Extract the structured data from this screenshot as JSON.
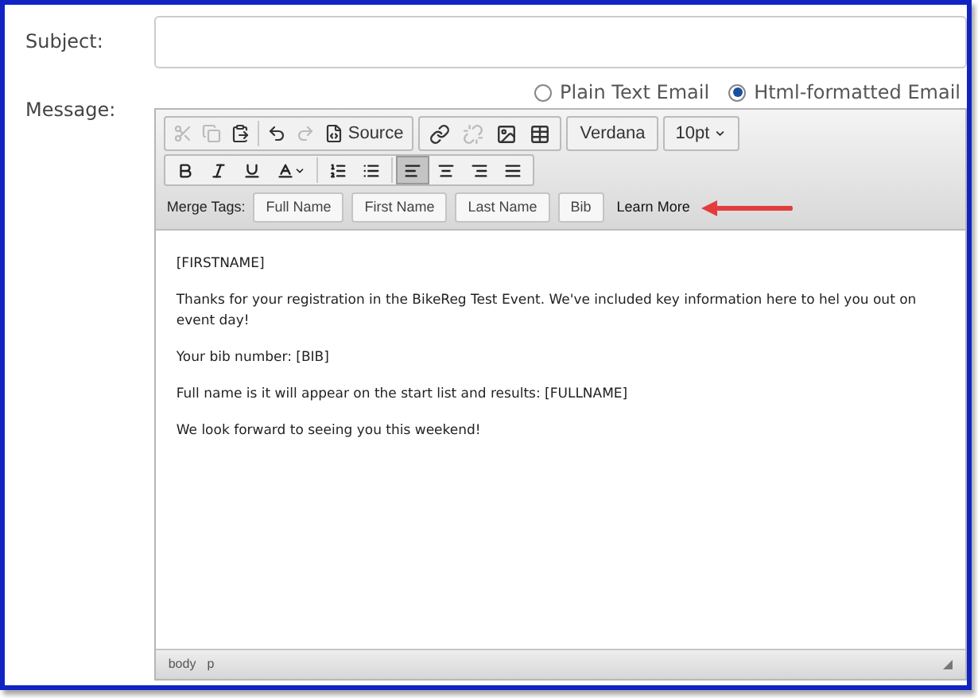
{
  "subject": {
    "label": "Subject:"
  },
  "message": {
    "label": "Message:"
  },
  "format_options": [
    {
      "label": "Plain Text Email",
      "selected": false
    },
    {
      "label": "Html-formatted Email",
      "selected": true
    }
  ],
  "toolbar_row_1": {
    "edit_group": [
      {
        "disabled": true
      },
      {
        "disabled": true
      },
      {
        "disabled": false
      },
      {
        "disabled": false
      },
      {
        "disabled": true
      },
      {
        "label": "Source",
        "disabled": false
      }
    ],
    "insert_group": [
      {
        "disabled": false
      },
      {
        "disabled": true
      },
      {
        "disabled": false
      },
      {
        "disabled": false
      }
    ],
    "font_family": {
      "value": "Verdana"
    },
    "font_size": {
      "value": "10pt"
    }
  },
  "toolbar_row_2": [
    {
      "selected": false
    },
    {
      "selected": false
    },
    {
      "selected": false
    },
    {
      "selected": false
    },
    {
      "selected": false
    },
    {
      "selected": false
    },
    {
      "selected": true
    },
    {
      "selected": false
    },
    {
      "selected": false
    },
    {
      "selected": false
    }
  ],
  "merge_tags": {
    "label": "Merge Tags:",
    "buttons": [
      "Full Name",
      "First Name",
      "Last Name",
      "Bib"
    ],
    "link": "Learn More"
  },
  "content": [
    "[FIRSTNAME]",
    "Thanks for your registration in the BikeReg Test Event. We've included key information here to hel you out on event day!",
    "Your bib number: [BIB]",
    "Full name is it will appear on the start list and results: [FULLNAME]",
    "We look forward to seeing you this weekend!"
  ],
  "status_path": [
    "body",
    "p"
  ]
}
